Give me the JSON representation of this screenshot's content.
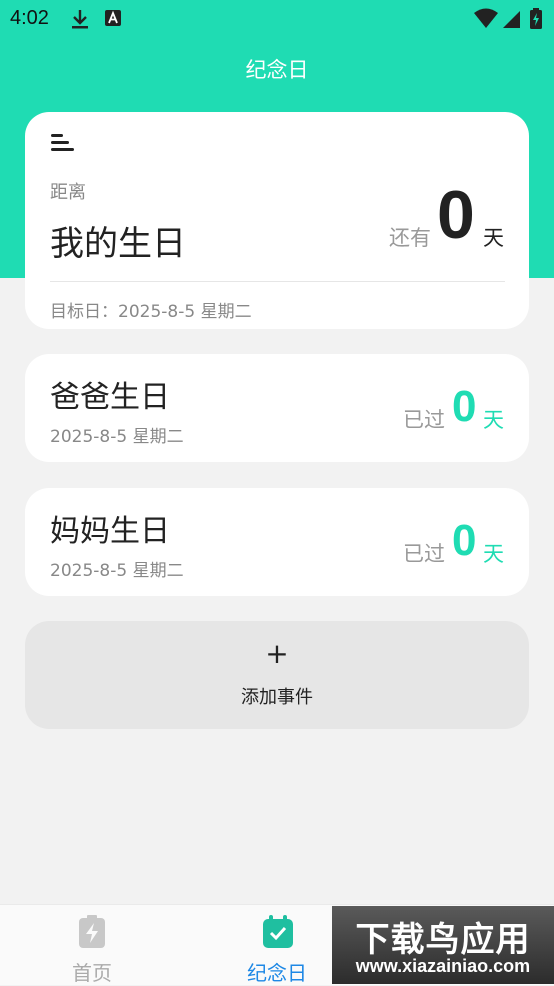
{
  "status_bar": {
    "time": "4:02",
    "icons": [
      "download-icon",
      "a-icon",
      "wifi-icon",
      "signal-icon",
      "battery-icon"
    ]
  },
  "header": {
    "title": "纪念日"
  },
  "featured": {
    "distance_label": "距离",
    "name": "我的生日",
    "remaining_label": "还有",
    "days": "0",
    "unit": "天",
    "target_date": "目标日：2025-8-5 星期二"
  },
  "events": [
    {
      "name": "爸爸生日",
      "date": "2025-8-5 星期二",
      "label": "已过",
      "days": "0",
      "unit": "天"
    },
    {
      "name": "妈妈生日",
      "date": "2025-8-5 星期二",
      "label": "已过",
      "days": "0",
      "unit": "天"
    }
  ],
  "add_event": {
    "plus": "+",
    "label": "添加事件"
  },
  "nav": [
    {
      "label": "首页",
      "icon": "battery-bolt-icon"
    },
    {
      "label": "纪念日",
      "icon": "calendar-check-icon"
    }
  ],
  "watermark": {
    "title": "下载鸟应用",
    "url": "www.xiazainiao.com"
  },
  "colors": {
    "accent": "#1fdcb3",
    "active_nav": "#1e88e5"
  }
}
